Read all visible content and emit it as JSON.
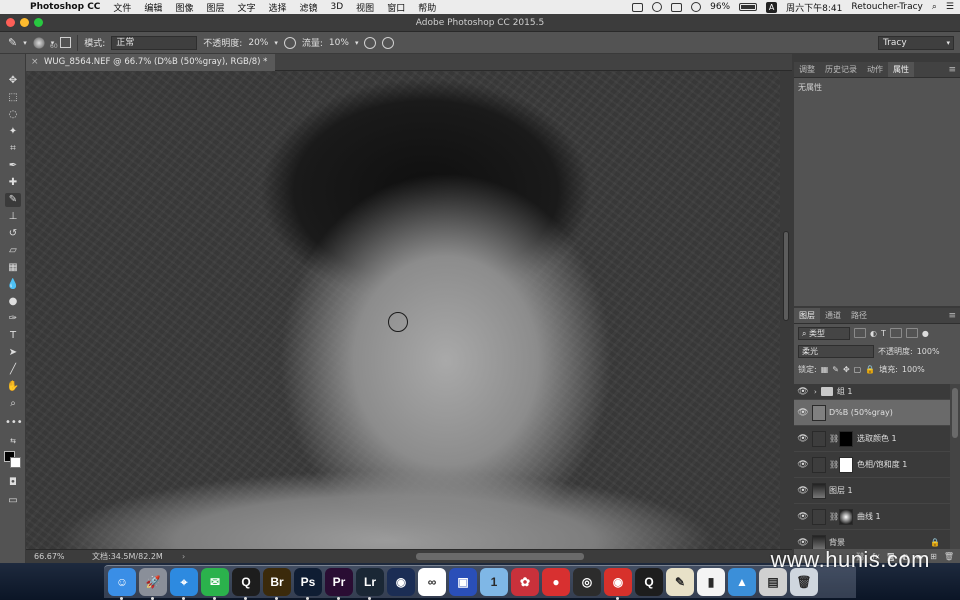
{
  "menubar": {
    "app_name": "Photoshop CC",
    "items": [
      "文件",
      "编辑",
      "图像",
      "图层",
      "文字",
      "选择",
      "滤镜",
      "3D",
      "视图",
      "窗口",
      "帮助"
    ],
    "battery": "96%",
    "input_method": "A",
    "clock": "周六下午8:41",
    "user": "Retoucher-Tracy"
  },
  "window": {
    "title": "Adobe Photoshop CC 2015.5"
  },
  "options": {
    "brush_size": "60",
    "mode_label": "模式:",
    "mode_value": "正常",
    "opacity_label": "不透明度:",
    "opacity_value": "20%",
    "flow_label": "流量:",
    "flow_value": "10%",
    "workspace": "Tracy"
  },
  "document": {
    "tab_title": "WUG_8564.NEF @ 66.7% (D%B (50%gray), RGB/8) *",
    "close_glyph": "×",
    "zoom": "66.67%",
    "doc_size": "文档:34.5M/82.2M",
    "arrow": "›"
  },
  "properties_panel": {
    "tabs": [
      "调整",
      "历史记录",
      "动作",
      "属性"
    ],
    "active_tab": "属性",
    "body_text": "无属性",
    "menu_glyph": "≡"
  },
  "layers_panel": {
    "tabs": [
      "图层",
      "通道",
      "路径"
    ],
    "active_tab": "图层",
    "menu_glyph": "≡",
    "filter_kind": "类型",
    "blend_mode": "柔光",
    "opacity_label": "不透明度:",
    "opacity_value": "100%",
    "lock_label": "锁定:",
    "fill_label": "填充:",
    "fill_value": "100%",
    "layers": [
      {
        "name": "组 1",
        "kind": "group",
        "visible": true,
        "selected": false
      },
      {
        "name": "D%B (50%gray)",
        "kind": "gray",
        "visible": true,
        "selected": true
      },
      {
        "name": "选取颜色 1",
        "kind": "adjustment",
        "visible": true,
        "selected": false,
        "mask": "black"
      },
      {
        "name": "色相/饱和度 1",
        "kind": "adjustment",
        "visible": true,
        "selected": false,
        "mask": "white"
      },
      {
        "name": "图层 1",
        "kind": "photo",
        "visible": true,
        "selected": false
      },
      {
        "name": "曲线 1",
        "kind": "adjustment",
        "visible": true,
        "selected": false,
        "mask": "radial"
      },
      {
        "name": "背景",
        "kind": "photo",
        "visible": true,
        "selected": false
      }
    ]
  },
  "dock": {
    "apps": [
      {
        "name": "Finder",
        "label": "☺",
        "color": "#3a8ee6"
      },
      {
        "name": "Launchpad",
        "label": "🚀",
        "color": "#8a8f99"
      },
      {
        "name": "Safari",
        "label": "⌖",
        "color": "#2d8ae0"
      },
      {
        "name": "WeChat",
        "label": "✉",
        "color": "#2bb24c"
      },
      {
        "name": "QQ",
        "label": "Q",
        "color": "#1d1d1d"
      },
      {
        "name": "Bridge",
        "label": "Br",
        "color": "#3b2a0b"
      },
      {
        "name": "Photoshop",
        "label": "Ps",
        "color": "#0f1d33"
      },
      {
        "name": "Premiere",
        "label": "Pr",
        "color": "#2a0d33"
      },
      {
        "name": "Lightroom",
        "label": "Lr",
        "color": "#1a2735"
      },
      {
        "name": "Cinema 4D",
        "label": "◉",
        "color": "#1b2d54"
      },
      {
        "name": "Baidu Netdisk",
        "label": "∞",
        "color": "#ffffff"
      },
      {
        "name": "Video Editor",
        "label": "▣",
        "color": "#2a4fb8"
      },
      {
        "name": "1Password",
        "label": "1",
        "color": "#7fb7e6"
      },
      {
        "name": "DaVinci",
        "label": "✿",
        "color": "#c9313b"
      },
      {
        "name": "Recorder",
        "label": "●",
        "color": "#d83030"
      },
      {
        "name": "OBS",
        "label": "◎",
        "color": "#2c2c2c"
      },
      {
        "name": "NetEase Music",
        "label": "◉",
        "color": "#d7312b"
      },
      {
        "name": "Screen Capture",
        "label": "Q",
        "color": "#1d1d1d"
      },
      {
        "name": "TextEdit",
        "label": "✎",
        "color": "#e8e1c8"
      },
      {
        "name": "Numbers",
        "label": "▮",
        "color": "#f4f4f4"
      },
      {
        "name": "Keynote",
        "label": "▲",
        "color": "#3b8fd9"
      },
      {
        "name": "Preview",
        "label": "▤",
        "color": "#d0d0d0"
      },
      {
        "name": "Trash",
        "label": "🗑",
        "color": "#cfd6de"
      }
    ]
  },
  "watermark": "www.hunis.com"
}
